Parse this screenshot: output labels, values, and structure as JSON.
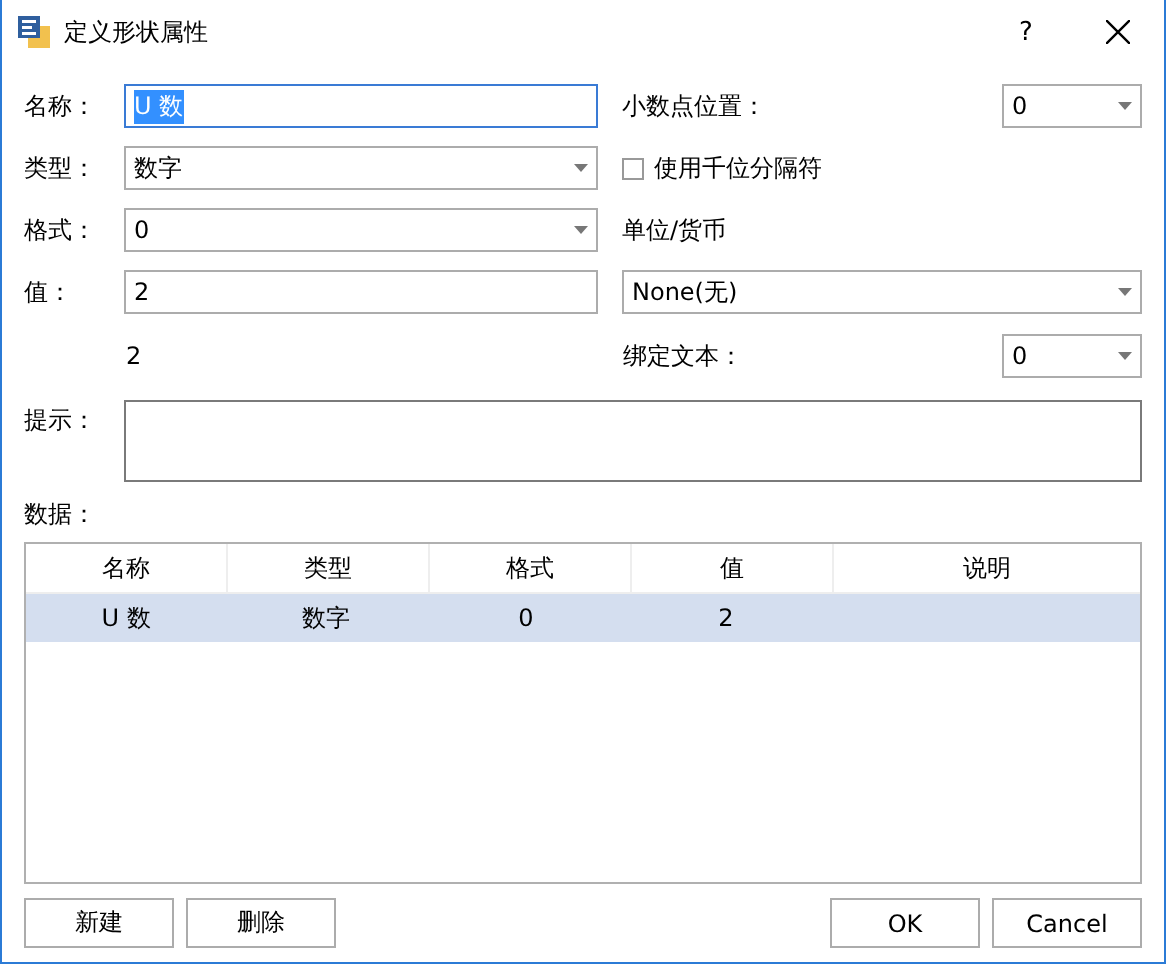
{
  "window": {
    "title": "定义形状属性",
    "help": "?"
  },
  "name": {
    "label": "名称：",
    "value": "U 数",
    "selected": true
  },
  "decimal": {
    "label": "小数点位置：",
    "value": "0"
  },
  "type": {
    "label": "类型：",
    "value": "数字"
  },
  "thousands": {
    "label": "使用千位分隔符",
    "checked": false
  },
  "format": {
    "label": "格式：",
    "value": "0"
  },
  "unit": {
    "label": "单位/货币",
    "value": "None(无)"
  },
  "value": {
    "label": "值：",
    "value": "2"
  },
  "preview": "2",
  "bind": {
    "label": "绑定文本：",
    "value": "0"
  },
  "hint": {
    "label": "提示："
  },
  "data_label": "数据：",
  "table": {
    "columns": [
      "名称",
      "类型",
      "格式",
      "值",
      "说明"
    ],
    "rows": [
      {
        "cells": [
          "U 数",
          "数字",
          "0",
          "2",
          ""
        ],
        "selected": true
      }
    ]
  },
  "buttons_left": [
    "新建",
    "删除"
  ],
  "buttons_right": [
    "OK",
    "Cancel"
  ]
}
